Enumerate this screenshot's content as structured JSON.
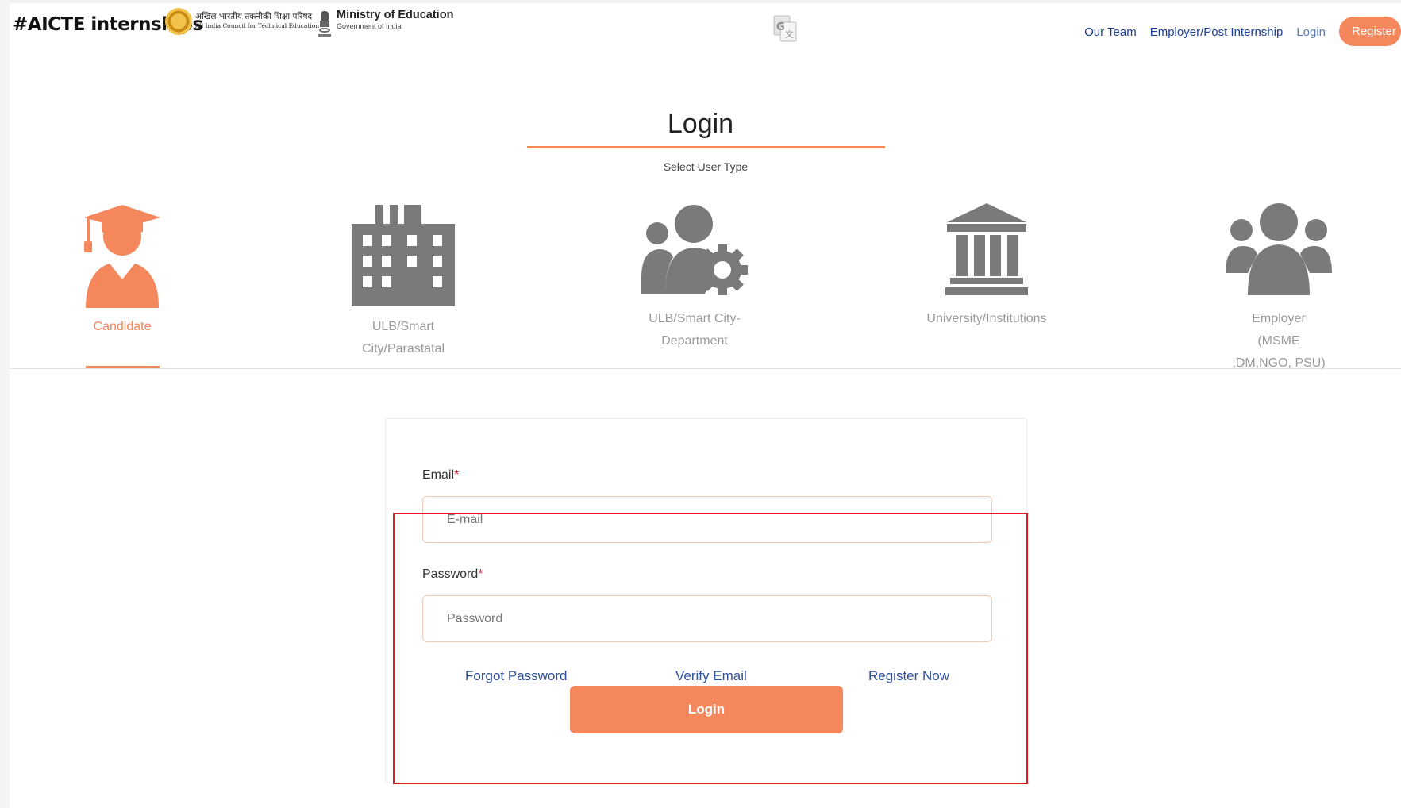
{
  "header": {
    "brand": "#AICTE internships",
    "aicte_hindi": "अखिल भारतीय तकनीकी शिक्षा परिषद",
    "aicte_english": "All India Council for Technical Education",
    "moe_title": "Ministry of Education",
    "moe_sub": "Government of India",
    "nav": {
      "our_team": "Our Team",
      "employer_post": "Employer/Post Internship",
      "login": "Login",
      "register": "Register"
    }
  },
  "page": {
    "title": "Login",
    "subtitle": "Select User Type"
  },
  "user_types": [
    {
      "label": "Candidate",
      "icon": "graduate-icon",
      "active": true
    },
    {
      "label": "ULB/Smart City/Parastatal",
      "icon": "building-icon",
      "active": false
    },
    {
      "label": "ULB/Smart City-Department",
      "icon": "users-gear-icon",
      "active": false
    },
    {
      "label": "University/Institutions",
      "icon": "institution-icon",
      "active": false
    },
    {
      "label": "Employer (MSME ,DM,NGO, PSU)",
      "icon": "group-icon",
      "active": false
    }
  ],
  "form": {
    "email_label": "Email",
    "email_placeholder": "E-mail",
    "password_label": "Password",
    "password_placeholder": "Password",
    "required_mark": "*",
    "forgot_password": "Forgot Password",
    "verify_email": "Verify Email",
    "register_now": "Register Now",
    "login_button": "Login"
  },
  "colors": {
    "accent": "#f4875c",
    "link": "#1c3f9a",
    "icon_gray": "#777777",
    "highlight": "#e01a1a"
  }
}
